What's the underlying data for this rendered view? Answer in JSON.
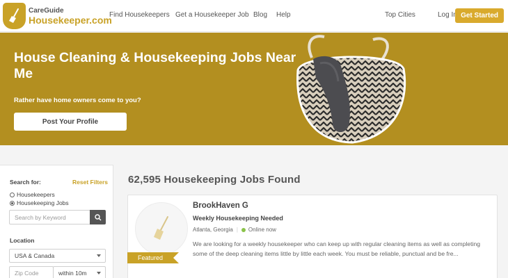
{
  "brand": {
    "small": "CareGuide",
    "big": "Housekeeper.com"
  },
  "nav": {
    "links": [
      "Find Housekeepers",
      "Get a Housekeeper Job",
      "Blog",
      "Help"
    ],
    "top_cities": "Top Cities",
    "login": "Log In",
    "cta": "Get Started"
  },
  "hero": {
    "title": "House Cleaning & Housekeeping Jobs Near Me",
    "subtitle": "Rather have home owners come to you?",
    "button": "Post Your Profile"
  },
  "sidebar": {
    "search_for": "Search for:",
    "reset": "Reset Filters",
    "options": [
      "Housekeepers",
      "Housekeeping Jobs"
    ],
    "keyword_placeholder": "Search by Keyword",
    "location_label": "Location",
    "country": "USA & Canada",
    "zip_placeholder": "Zip Code",
    "radius": "within 10m"
  },
  "results": {
    "count_title": "62,595 Housekeeping Jobs Found",
    "card": {
      "name": "BrookHaven G",
      "job_title": "Weekly Housekeeping Needed",
      "location": "Atlanta, Georgia",
      "status": "Online now",
      "description": "We are looking for a weekly housekeeper who can keep up with regular cleaning items as well as completing some of the deep cleaning items little by little each week. You must be reliable, punctual and be fre...",
      "badge": "Featured"
    }
  },
  "colors": {
    "accent": "#c9a227",
    "hero_bg": "#b38f20",
    "online": "#8bc34a"
  }
}
